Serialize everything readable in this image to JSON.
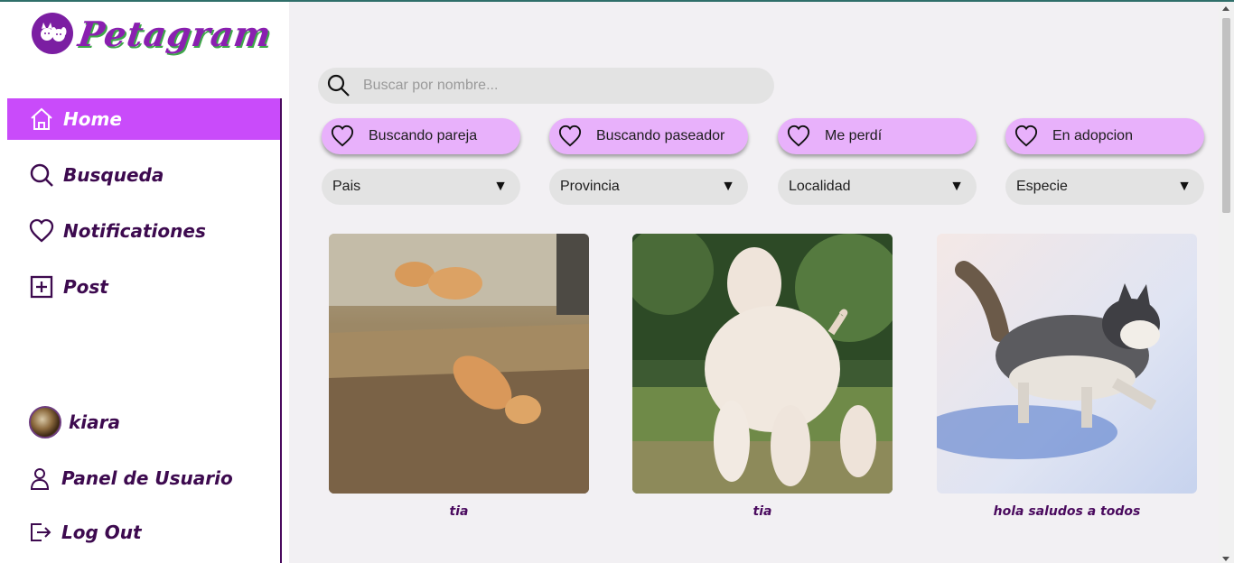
{
  "brand": {
    "name": "Petagram"
  },
  "sidebar": {
    "items": [
      {
        "label": "Home",
        "icon": "home-icon",
        "active": true
      },
      {
        "label": "Busqueda",
        "icon": "search-icon"
      },
      {
        "label": "Notificationes",
        "icon": "heart-icon"
      },
      {
        "label": "Post",
        "icon": "plus-square-icon"
      }
    ],
    "user": {
      "name": "kiara",
      "icon": "avatar"
    },
    "bottom": [
      {
        "label": "Panel de Usuario",
        "icon": "user-icon"
      },
      {
        "label": "Log Out",
        "icon": "logout-icon"
      }
    ]
  },
  "search": {
    "placeholder": "Buscar por nombre...",
    "value": ""
  },
  "tags": [
    {
      "label": "Buscando pareja",
      "icon": "heart-icon"
    },
    {
      "label": "Buscando paseador",
      "icon": "heart-icon"
    },
    {
      "label": "Me perdí",
      "icon": "heart-icon"
    },
    {
      "label": "En adopcion",
      "icon": "heart-icon"
    }
  ],
  "filters": [
    {
      "label": "Pais"
    },
    {
      "label": "Provincia"
    },
    {
      "label": "Localidad"
    },
    {
      "label": "Especie"
    }
  ],
  "posts": [
    {
      "caption": "tia",
      "image": "kittens-photo"
    },
    {
      "caption": "tia",
      "image": "afghan-hound-photo"
    },
    {
      "caption": "hola saludos a todos",
      "image": "husky-snow-photo"
    }
  ],
  "colors": {
    "accent": "#c94bfa",
    "tag_bg": "#e8b1fb",
    "text_dark": "#3d0a4f",
    "brand_purple": "#8a1fb0"
  }
}
